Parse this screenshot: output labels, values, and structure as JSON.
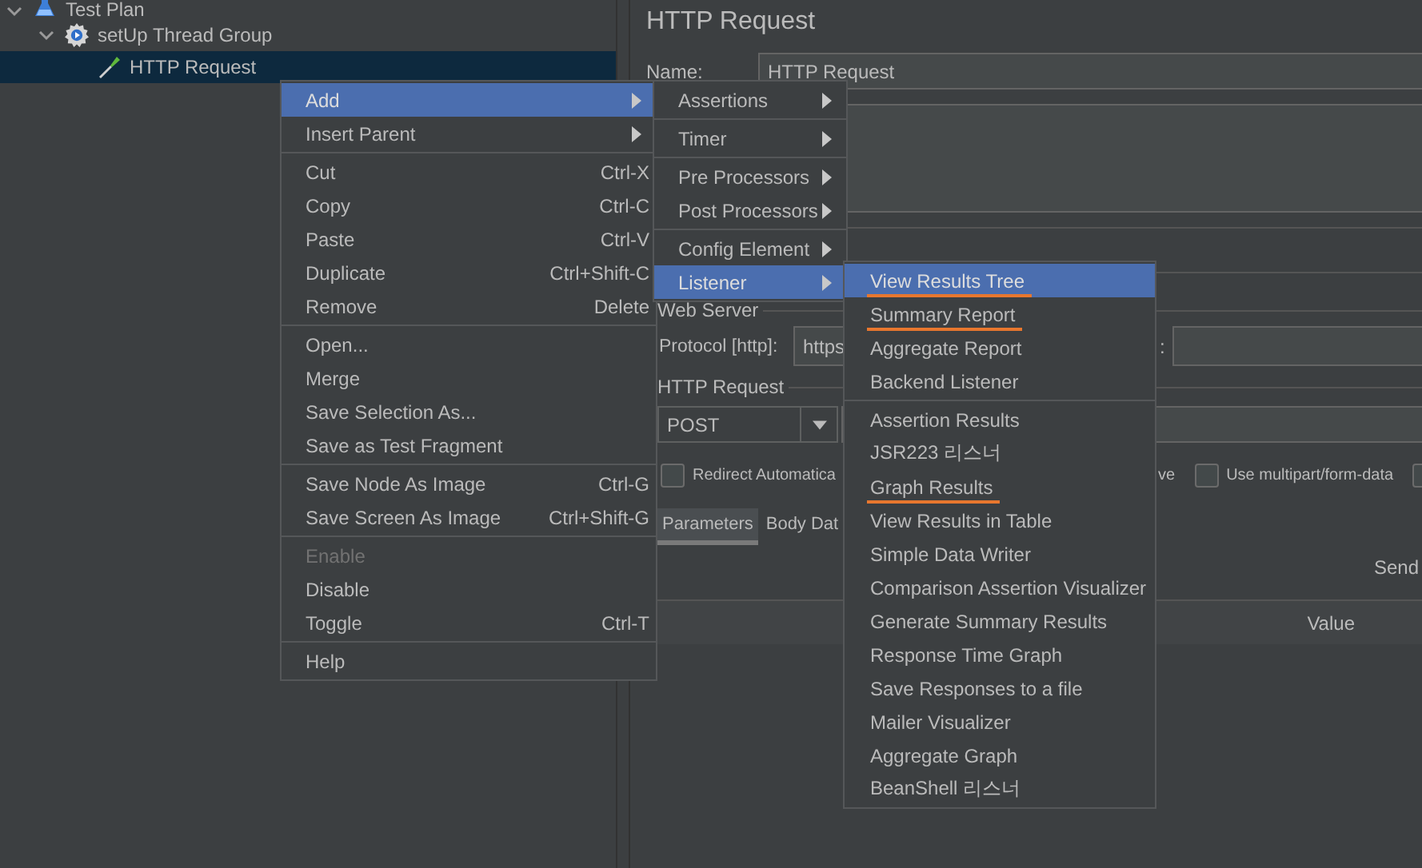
{
  "tree": [
    {
      "label": "Test Plan",
      "kind": "test-plan",
      "expanded": true,
      "selected": false,
      "children": [
        {
          "label": "setUp Thread Group",
          "kind": "thread-group",
          "expanded": true,
          "selected": false,
          "children": [
            {
              "label": "HTTP Request",
              "kind": "sampler",
              "selected": true
            }
          ]
        }
      ]
    }
  ],
  "editor": {
    "title": "HTTP Request",
    "name_label": "Name:",
    "name_value": "HTTP Request",
    "web_server_label": "Web Server",
    "protocol_label": "Protocol [http]:",
    "protocol_value": "https",
    "port_fragment": ":",
    "http_request_label": "HTTP Request",
    "method": "POST",
    "checkboxes_left": [
      {
        "label": "Redirect Automatica",
        "checked": false
      }
    ],
    "keepalive_fragment": "ve",
    "checkboxes_right": [
      {
        "label": "Use multipart/form-data",
        "checked": false
      },
      {
        "checked": false
      }
    ],
    "tabs": [
      {
        "label": "Parameters",
        "selected": true
      },
      {
        "label": "Body Dat",
        "selected": false
      }
    ],
    "send_fragment": "Send",
    "columns": [
      "Value"
    ]
  },
  "context_menu": {
    "groups": [
      [
        {
          "label": "Add",
          "submenu": true,
          "selected": true,
          "disabled": false
        },
        {
          "label": "Insert Parent",
          "submenu": true,
          "selected": false,
          "disabled": false
        }
      ],
      [
        {
          "label": "Cut",
          "shortcut": "Ctrl-X",
          "selected": false,
          "disabled": false
        },
        {
          "label": "Copy",
          "shortcut": "Ctrl-C",
          "selected": false,
          "disabled": false
        },
        {
          "label": "Paste",
          "shortcut": "Ctrl-V",
          "selected": false,
          "disabled": false
        },
        {
          "label": "Duplicate",
          "shortcut": "Ctrl+Shift-C",
          "selected": false,
          "disabled": false
        },
        {
          "label": "Remove",
          "shortcut": "Delete",
          "selected": false,
          "disabled": false
        }
      ],
      [
        {
          "label": "Open...",
          "selected": false,
          "disabled": false
        },
        {
          "label": "Merge",
          "selected": false,
          "disabled": false
        },
        {
          "label": "Save Selection As...",
          "selected": false,
          "disabled": false
        },
        {
          "label": "Save as Test Fragment",
          "selected": false,
          "disabled": false
        }
      ],
      [
        {
          "label": "Save Node As Image",
          "shortcut": "Ctrl-G",
          "selected": false,
          "disabled": false
        },
        {
          "label": "Save Screen As Image",
          "shortcut": "Ctrl+Shift-G",
          "selected": false,
          "disabled": false
        }
      ],
      [
        {
          "label": "Enable",
          "selected": false,
          "disabled": true
        },
        {
          "label": "Disable",
          "selected": false,
          "disabled": false
        },
        {
          "label": "Toggle",
          "shortcut": "Ctrl-T",
          "selected": false,
          "disabled": false
        }
      ],
      [
        {
          "label": "Help",
          "selected": false,
          "disabled": false
        }
      ]
    ]
  },
  "add_submenu": {
    "groups": [
      [
        {
          "label": "Assertions",
          "submenu": true,
          "selected": false
        }
      ],
      [
        {
          "label": "Timer",
          "submenu": true,
          "selected": false
        }
      ],
      [
        {
          "label": "Pre Processors",
          "submenu": true,
          "selected": false
        },
        {
          "label": "Post Processors",
          "submenu": true,
          "selected": false
        }
      ],
      [
        {
          "label": "Config Element",
          "submenu": true,
          "selected": false
        },
        {
          "label": "Listener",
          "submenu": true,
          "selected": true
        }
      ]
    ]
  },
  "listener_submenu": {
    "groups": [
      [
        {
          "label": "View Results Tree",
          "selected": true,
          "underlined": true
        },
        {
          "label": "Summary Report",
          "selected": false,
          "underlined": true
        },
        {
          "label": "Aggregate Report",
          "selected": false,
          "underlined": false
        },
        {
          "label": "Backend Listener",
          "selected": false,
          "underlined": false
        }
      ],
      [
        {
          "label": "Assertion Results",
          "selected": false,
          "underlined": false
        },
        {
          "label": "JSR223 리스너",
          "selected": false,
          "underlined": false
        },
        {
          "label": "Graph Results",
          "selected": false,
          "underlined": true
        },
        {
          "label": "View Results in Table",
          "selected": false,
          "underlined": false
        },
        {
          "label": "Simple Data Writer",
          "selected": false,
          "underlined": false
        },
        {
          "label": "Comparison Assertion Visualizer",
          "selected": false,
          "underlined": false
        },
        {
          "label": "Generate Summary Results",
          "selected": false,
          "underlined": false
        },
        {
          "label": "Response Time Graph",
          "selected": false,
          "underlined": false
        },
        {
          "label": "Save Responses to a file",
          "selected": false,
          "underlined": false
        },
        {
          "label": "Mailer Visualizer",
          "selected": false,
          "underlined": false
        },
        {
          "label": "Aggregate Graph",
          "selected": false,
          "underlined": false
        },
        {
          "label": "BeanShell 리스너",
          "selected": false,
          "underlined": false
        }
      ]
    ]
  }
}
